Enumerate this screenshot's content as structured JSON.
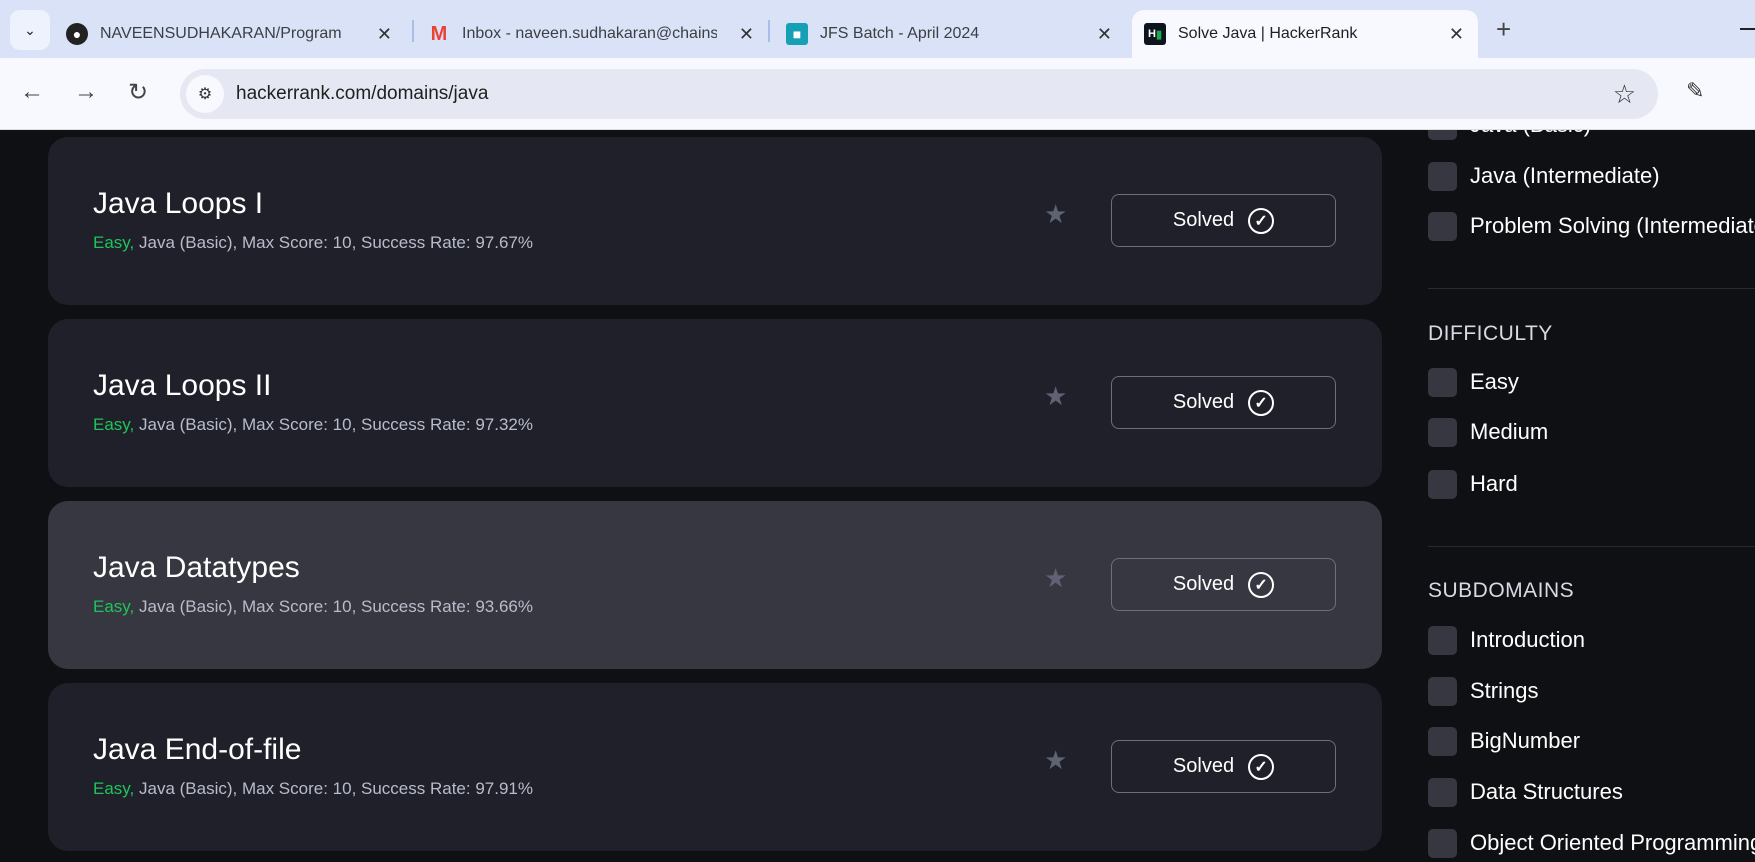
{
  "browser": {
    "tabs": [
      {
        "title": "NAVEENSUDHAKARAN/Program",
        "icon": "github-icon"
      },
      {
        "title": "Inbox - naveen.sudhakaran@chainsys.com",
        "icon": "gmail-icon"
      },
      {
        "title": "JFS Batch - April 2024",
        "icon": "classroom-icon"
      },
      {
        "title": "Solve Java | HackerRank",
        "icon": "hackerrank-icon",
        "active": true
      }
    ],
    "url": "hackerrank.com/domains/java"
  },
  "challenges": [
    {
      "title": "Java Loops I",
      "difficulty": "Easy,",
      "meta": " Java (Basic), Max Score: 10, Success Rate: 97.67%",
      "status": "Solved"
    },
    {
      "title": "Java Loops II",
      "difficulty": "Easy,",
      "meta": " Java (Basic), Max Score: 10, Success Rate: 97.32%",
      "status": "Solved"
    },
    {
      "title": "Java Datatypes",
      "difficulty": "Easy,",
      "meta": " Java (Basic), Max Score: 10, Success Rate: 93.66%",
      "status": "Solved",
      "hovered": true
    },
    {
      "title": "Java End-of-file",
      "difficulty": "Easy,",
      "meta": " Java (Basic), Max Score: 10, Success Rate: 97.91%",
      "status": "Solved"
    }
  ],
  "filters": {
    "skills": [
      "Java (Basic)",
      "Java (Intermediate)",
      "Problem Solving (Intermediate)"
    ],
    "difficulty_heading": "DIFFICULTY",
    "difficulty": [
      "Easy",
      "Medium",
      "Hard"
    ],
    "subdomains_heading": "SUBDOMAINS",
    "subdomains": [
      "Introduction",
      "Strings",
      "BigNumber",
      "Data Structures",
      "Object Oriented Programming"
    ]
  },
  "colors": {
    "easy": "#1ec45a",
    "card": "#1f2029",
    "card_hover": "#363740",
    "page": "#0f1014"
  }
}
